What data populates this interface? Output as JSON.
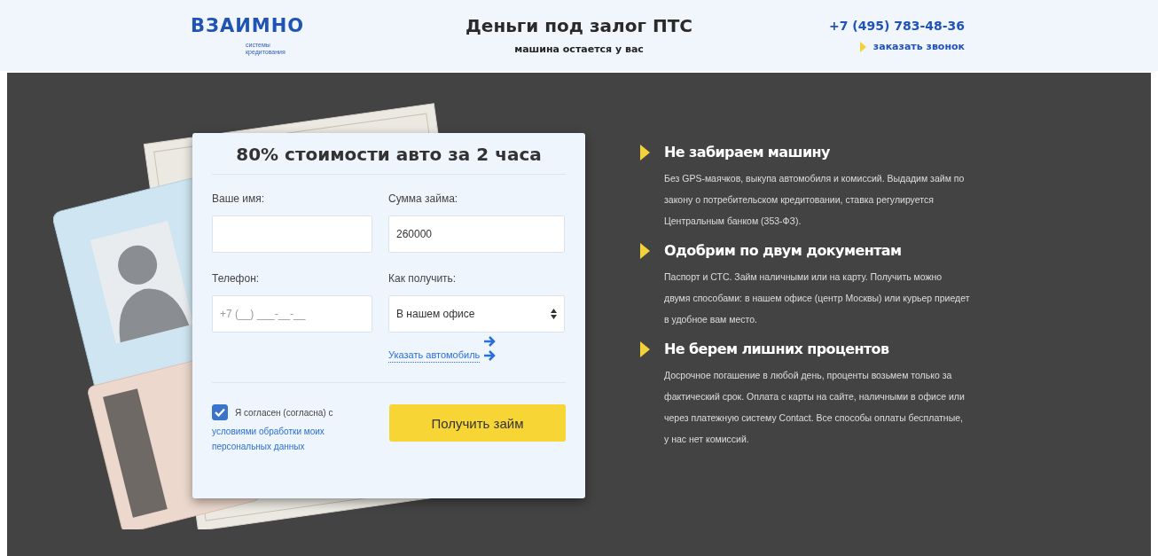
{
  "header": {
    "logo": {
      "name": "ВЗАИМНО",
      "tagline": "системы кредитования"
    },
    "title": "Деньги под залог ПТС",
    "subtitle": "машина остается у вас",
    "phone": "+7 (495) 783-48-36",
    "callback_link": "заказать звонок"
  },
  "form": {
    "title": "80% стоимости авто за 2 часа",
    "fields": [
      {
        "kind": "text",
        "label": "Ваше имя:"
      },
      {
        "kind": "text",
        "label": "Сумма займа:",
        "value": "260000"
      },
      {
        "kind": "text",
        "label": "Телефон:",
        "placeholder": "+7 (__) ___-__-__"
      },
      {
        "kind": "select",
        "label": "Как получить:",
        "value": "В нашем офисе"
      }
    ],
    "car_link": "Указать автомобиль",
    "consent": {
      "checked": true,
      "text": "Я согласен (согласна) с",
      "link": "условиями обработки моих персональных данных"
    },
    "submit": "Получить займ"
  },
  "features": [
    {
      "title": "Не забираем машину",
      "text": "Без GPS-маячков, выкупа автомобиля и комиссий. Выдадим займ по закону о потребительском кредитовании, ставка регулируется Центральным банком (353-ФЗ)."
    },
    {
      "title": "Одобрим по двум документам",
      "text": "Паспорт и СТС. Займ наличными или на карту. Получить можно двумя способами: в нашем офисе (центр Москвы) или курьер приедет в удобное вам место."
    },
    {
      "title": "Не берем лишних процентов",
      "text": "Досрочное погашение в любой день, проценты возьмем только за фактический срок. Оплата с карты на сайте, наличными в офисе или через платежную систему Contact. Все способы оплаты бесплатные, у нас нет комиссий."
    }
  ]
}
